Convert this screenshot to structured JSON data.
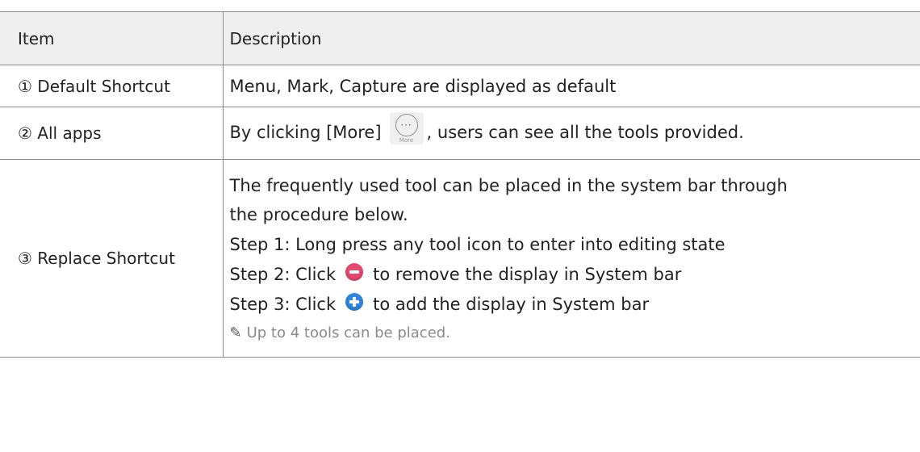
{
  "header": {
    "item": "Item",
    "description": "Description"
  },
  "rows": [
    {
      "item": "① Default Shortcut",
      "description": "Menu, Mark, Capture are displayed as default"
    },
    {
      "item": "② All apps",
      "desc_before": "By clicking [More]",
      "icon_label": "More",
      "desc_after": ", users can see all the tools provided."
    },
    {
      "item": "③ Replace Shortcut",
      "line1": "The frequently used tool can be placed in the system bar through",
      "line2": "the procedure below.",
      "step1": "Step 1: Long press any tool icon to enter into editing state",
      "step2_before": "Step 2: Click",
      "step2_after": "to remove the display in System bar",
      "step3_before": "Step 3: Click",
      "step3_after": "to add the display in System bar",
      "note": "Up to 4 tools can be placed."
    }
  ],
  "colors": {
    "header_bg": "#efefef",
    "border": "#8c8c8c",
    "remove_icon": "#e8476f",
    "add_icon": "#2f86e0",
    "note_text": "#8a8a8a"
  },
  "icons": {
    "more": "more-icon",
    "remove": "minus-circle-icon",
    "add": "plus-circle-icon",
    "note": "pencil-icon"
  }
}
